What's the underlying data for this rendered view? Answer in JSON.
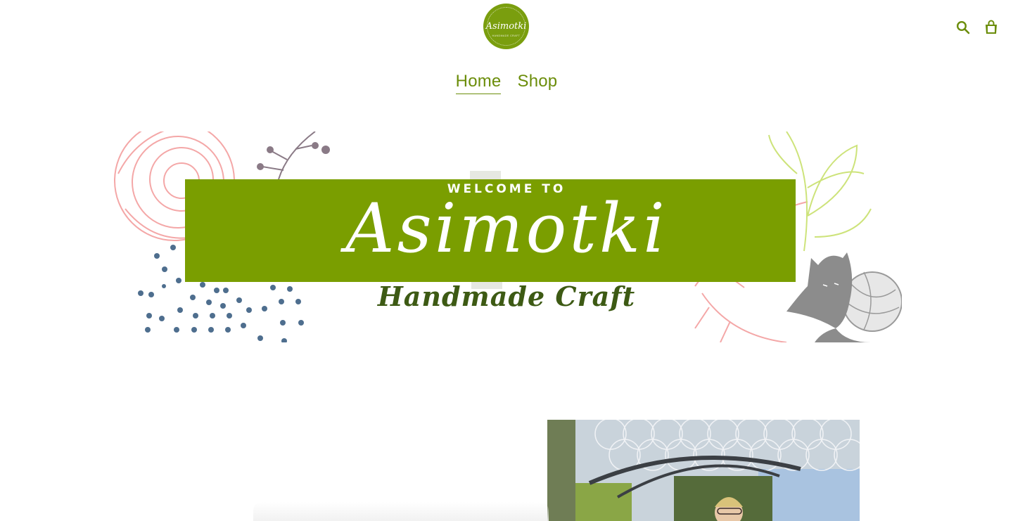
{
  "header": {
    "logo": {
      "text": "Asimotki",
      "subtext": "HANDMADE CRAFT",
      "icon": "logo-badge"
    },
    "search_icon": "search-icon",
    "cart_icon": "cart-icon"
  },
  "nav": {
    "items": [
      {
        "label": "Home",
        "active": true
      },
      {
        "label": "Shop",
        "active": false
      }
    ]
  },
  "banner": {
    "welcome": "WELCOME TO",
    "title": "Asimotki",
    "tagline": "Handmade Craft"
  },
  "colors": {
    "brand_green": "#7a9e00",
    "text_green": "#6b8d0a",
    "tagline_green": "#3d5a14",
    "pink": "#f4a7a7",
    "blue_dots": "#4e6e8e",
    "lime": "#cde37a",
    "grey_cat": "#8c8c8c"
  }
}
